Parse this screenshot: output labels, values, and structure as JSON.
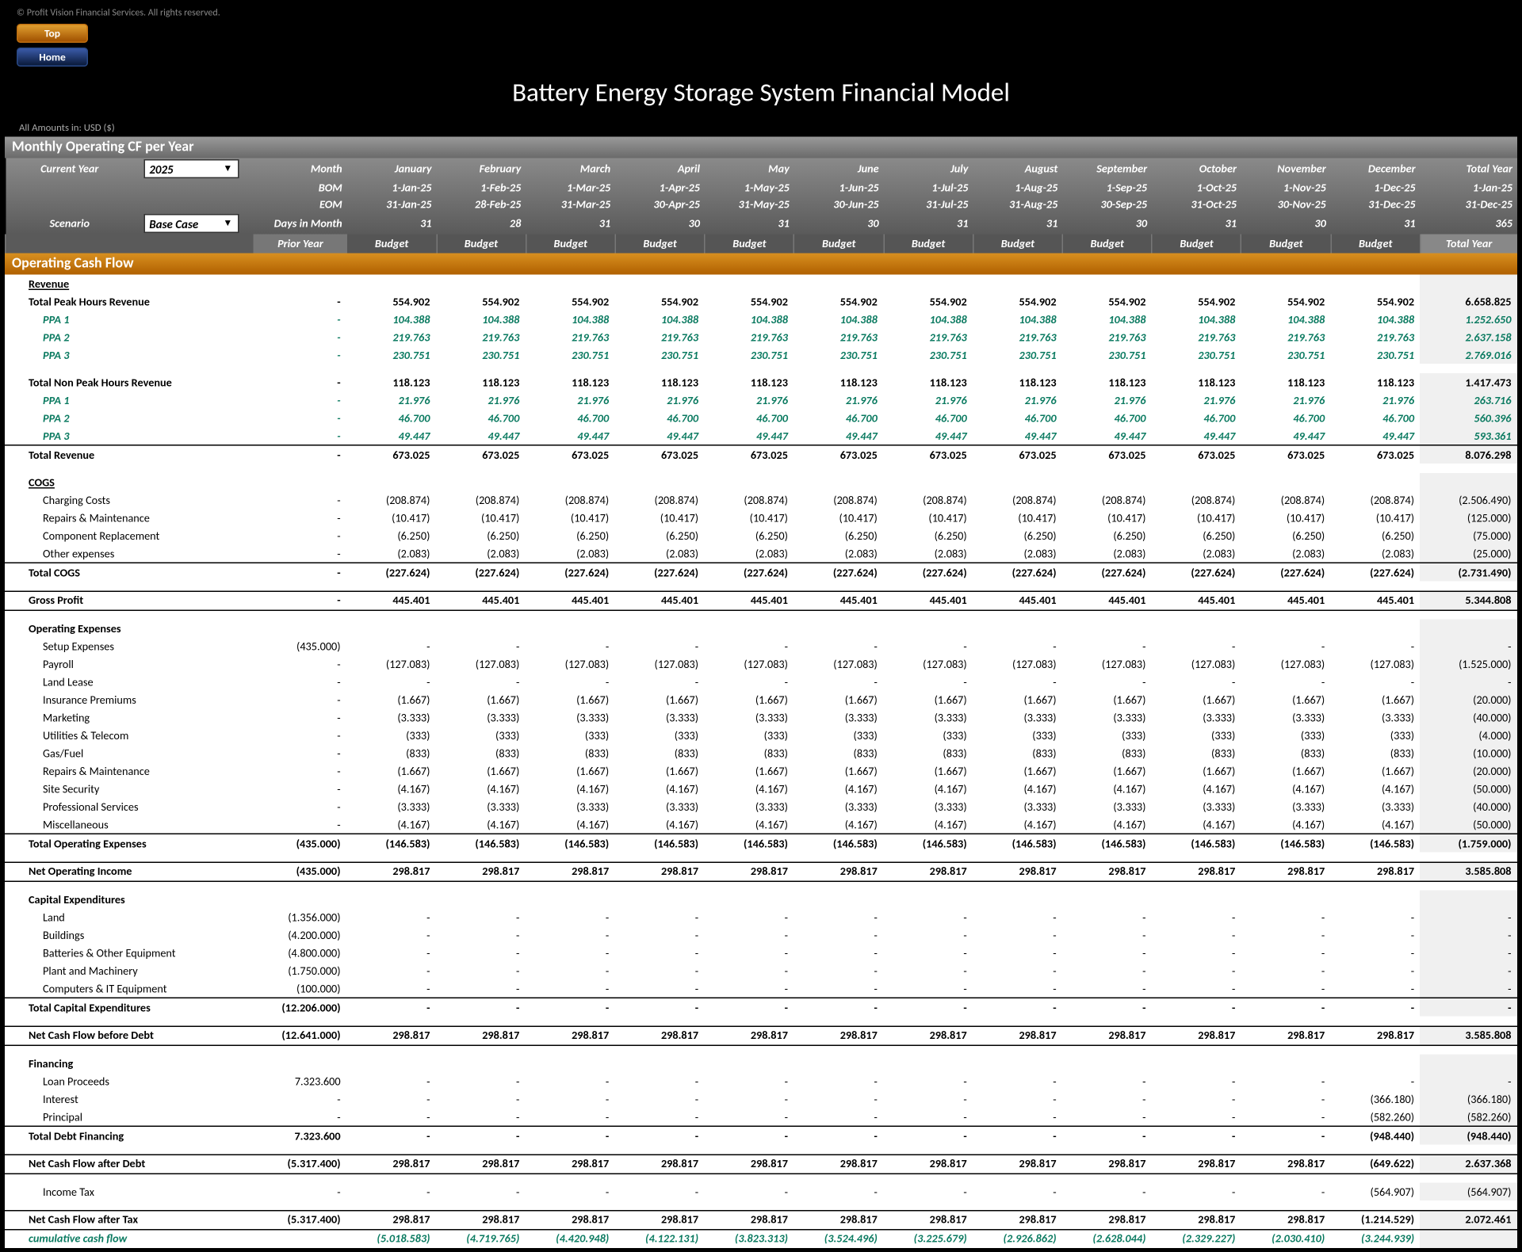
{
  "copyright": "© Profit Vision Financial Services. All rights reserved.",
  "nav": {
    "top": "Top",
    "home": "Home"
  },
  "title": "Battery Energy Storage System Financial Model",
  "amounts_note": "All Amounts in: USD ($)",
  "section_title": "Monthly Operating CF per Year",
  "controls": {
    "current_year_label": "Current Year",
    "current_year_value": "2025",
    "scenario_label": "Scenario",
    "scenario_value": "Base Case"
  },
  "header": {
    "month_label": "Month",
    "bom_label": "BOM",
    "eom_label": "EOM",
    "days_label": "Days in Month",
    "months": [
      "January",
      "February",
      "March",
      "April",
      "May",
      "June",
      "July",
      "August",
      "September",
      "October",
      "November",
      "December"
    ],
    "bom": [
      "1-Jan-25",
      "1-Feb-25",
      "1-Mar-25",
      "1-Apr-25",
      "1-May-25",
      "1-Jun-25",
      "1-Jul-25",
      "1-Aug-25",
      "1-Sep-25",
      "1-Oct-25",
      "1-Nov-25",
      "1-Dec-25"
    ],
    "eom": [
      "31-Jan-25",
      "28-Feb-25",
      "31-Mar-25",
      "30-Apr-25",
      "31-May-25",
      "30-Jun-25",
      "31-Jul-25",
      "31-Aug-25",
      "30-Sep-25",
      "31-Oct-25",
      "30-Nov-25",
      "31-Dec-25"
    ],
    "days": [
      "31",
      "28",
      "31",
      "30",
      "31",
      "30",
      "31",
      "31",
      "30",
      "31",
      "30",
      "31"
    ],
    "total_year": "Total Year",
    "total_bom": "1-Jan-25",
    "total_eom": "31-Dec-25",
    "total_days": "365",
    "prior_year": "Prior Year",
    "budget": "Budget"
  },
  "ocf_title": "Operating Cash Flow",
  "rows": [
    {
      "t": "sechead",
      "label": "Revenue"
    },
    {
      "t": "bold",
      "label": "Total Peak Hours Revenue",
      "prior": "-",
      "m": "554.902",
      "total": "6.658.825"
    },
    {
      "t": "ppa",
      "label": "PPA 1",
      "prior": "-",
      "m": "104.388",
      "total": "1.252.650"
    },
    {
      "t": "ppa",
      "label": "PPA 2",
      "prior": "-",
      "m": "219.763",
      "total": "2.637.158"
    },
    {
      "t": "ppa",
      "label": "PPA 3",
      "prior": "-",
      "m": "230.751",
      "total": "2.769.016"
    },
    {
      "t": "spacer"
    },
    {
      "t": "bold",
      "label": "Total Non Peak Hours Revenue",
      "prior": "-",
      "m": "118.123",
      "total": "1.417.473"
    },
    {
      "t": "ppa",
      "label": "PPA 1",
      "prior": "-",
      "m": "21.976",
      "total": "263.716"
    },
    {
      "t": "ppa",
      "label": "PPA 2",
      "prior": "-",
      "m": "46.700",
      "total": "560.396"
    },
    {
      "t": "ppa",
      "label": "PPA 3",
      "prior": "-",
      "m": "49.447",
      "total": "593.361"
    },
    {
      "t": "totalline",
      "label": "Total Revenue",
      "prior": "-",
      "m": "673.025",
      "total": "8.076.298"
    },
    {
      "t": "spacer"
    },
    {
      "t": "sechead",
      "label": "COGS"
    },
    {
      "t": "sub",
      "label": "Charging Costs",
      "prior": "-",
      "m": "(208.874)",
      "total": "(2.506.490)"
    },
    {
      "t": "sub",
      "label": "Repairs & Maintenance",
      "prior": "-",
      "m": "(10.417)",
      "total": "(125.000)"
    },
    {
      "t": "sub",
      "label": "Component Replacement",
      "prior": "-",
      "m": "(6.250)",
      "total": "(75.000)"
    },
    {
      "t": "sub",
      "label": "Other expenses",
      "prior": "-",
      "m": "(2.083)",
      "total": "(25.000)"
    },
    {
      "t": "totalline",
      "label": "Total COGS",
      "prior": "-",
      "m": "(227.624)",
      "total": "(2.731.490)"
    },
    {
      "t": "spacer"
    },
    {
      "t": "totalline",
      "label": "Gross Profit",
      "prior": "-",
      "m": "445.401",
      "total": "5.344.808",
      "double": true
    },
    {
      "t": "spacer"
    },
    {
      "t": "bold",
      "label": "Operating Expenses"
    },
    {
      "t": "sub",
      "label": "Setup Expenses",
      "prior": "(435.000)",
      "m": "-",
      "total": "-"
    },
    {
      "t": "sub",
      "label": "Payroll",
      "prior": "-",
      "m": "(127.083)",
      "total": "(1.525.000)"
    },
    {
      "t": "sub",
      "label": "Land Lease",
      "prior": "-",
      "m": "-",
      "total": "-"
    },
    {
      "t": "sub",
      "label": "Insurance Premiums",
      "prior": "-",
      "m": "(1.667)",
      "total": "(20.000)"
    },
    {
      "t": "sub",
      "label": "Marketing",
      "prior": "-",
      "m": "(3.333)",
      "total": "(40.000)"
    },
    {
      "t": "sub",
      "label": "Utilities & Telecom",
      "prior": "-",
      "m": "(333)",
      "total": "(4.000)"
    },
    {
      "t": "sub",
      "label": "Gas/Fuel",
      "prior": "-",
      "m": "(833)",
      "total": "(10.000)"
    },
    {
      "t": "sub",
      "label": "Repairs & Maintenance",
      "prior": "-",
      "m": "(1.667)",
      "total": "(20.000)"
    },
    {
      "t": "sub",
      "label": "Site Security",
      "prior": "-",
      "m": "(4.167)",
      "total": "(50.000)"
    },
    {
      "t": "sub",
      "label": "Professional Services",
      "prior": "-",
      "m": "(3.333)",
      "total": "(40.000)"
    },
    {
      "t": "sub",
      "label": "Miscellaneous",
      "prior": "-",
      "m": "(4.167)",
      "total": "(50.000)"
    },
    {
      "t": "totalline",
      "label": "Total Operating Expenses",
      "prior": "(435.000)",
      "m": "(146.583)",
      "total": "(1.759.000)"
    },
    {
      "t": "spacer"
    },
    {
      "t": "totalline",
      "label": "Net Operating Income",
      "prior": "(435.000)",
      "m": "298.817",
      "total": "3.585.808",
      "double": true
    },
    {
      "t": "spacer"
    },
    {
      "t": "bold",
      "label": "Capital Expenditures"
    },
    {
      "t": "sub",
      "label": "Land",
      "prior": "(1.356.000)",
      "m": "-",
      "total": "-"
    },
    {
      "t": "sub",
      "label": "Buildings",
      "prior": "(4.200.000)",
      "m": "-",
      "total": "-"
    },
    {
      "t": "sub",
      "label": "Batteries & Other Equipment",
      "prior": "(4.800.000)",
      "m": "-",
      "total": "-"
    },
    {
      "t": "sub",
      "label": "Plant and Machinery",
      "prior": "(1.750.000)",
      "m": "-",
      "total": "-"
    },
    {
      "t": "sub",
      "label": "Computers & IT Equipment",
      "prior": "(100.000)",
      "m": "-",
      "total": "-"
    },
    {
      "t": "totalline",
      "label": "Total Capital Expenditures",
      "prior": "(12.206.000)",
      "m": "-",
      "total": "-"
    },
    {
      "t": "spacer"
    },
    {
      "t": "totalline",
      "label": "Net Cash Flow before Debt",
      "prior": "(12.641.000)",
      "m": "298.817",
      "total": "3.585.808",
      "double": true
    },
    {
      "t": "spacer"
    },
    {
      "t": "bold",
      "label": "Financing"
    },
    {
      "t": "sub",
      "label": "Loan Proceeds",
      "prior": "7.323.600",
      "m": "-",
      "total": "-"
    },
    {
      "t": "sub",
      "label": "Interest",
      "prior": "-",
      "vals": [
        "-",
        "-",
        "-",
        "-",
        "-",
        "-",
        "-",
        "-",
        "-",
        "-",
        "-",
        "(366.180)"
      ],
      "total": "(366.180)"
    },
    {
      "t": "sub",
      "label": "Principal",
      "prior": "-",
      "vals": [
        "-",
        "-",
        "-",
        "-",
        "-",
        "-",
        "-",
        "-",
        "-",
        "-",
        "-",
        "(582.260)"
      ],
      "total": "(582.260)"
    },
    {
      "t": "totalline",
      "label": "Total Debt Financing",
      "prior": "7.323.600",
      "vals": [
        "-",
        "-",
        "-",
        "-",
        "-",
        "-",
        "-",
        "-",
        "-",
        "-",
        "-",
        "(948.440)"
      ],
      "total": "(948.440)"
    },
    {
      "t": "spacer"
    },
    {
      "t": "totalline",
      "label": "Net Cash Flow after Debt",
      "prior": "(5.317.400)",
      "vals": [
        "298.817",
        "298.817",
        "298.817",
        "298.817",
        "298.817",
        "298.817",
        "298.817",
        "298.817",
        "298.817",
        "298.817",
        "298.817",
        "(649.622)"
      ],
      "total": "2.637.368",
      "double": true
    },
    {
      "t": "spacer"
    },
    {
      "t": "sub",
      "label": "Income Tax",
      "prior": "-",
      "vals": [
        "-",
        "-",
        "-",
        "-",
        "-",
        "-",
        "-",
        "-",
        "-",
        "-",
        "-",
        "(564.907)"
      ],
      "total": "(564.907)"
    },
    {
      "t": "spacer"
    },
    {
      "t": "totalline",
      "label": "Net Cash Flow after Tax",
      "prior": "(5.317.400)",
      "vals": [
        "298.817",
        "298.817",
        "298.817",
        "298.817",
        "298.817",
        "298.817",
        "298.817",
        "298.817",
        "298.817",
        "298.817",
        "298.817",
        "(1.214.529)"
      ],
      "total": "2.072.461",
      "double": true
    },
    {
      "t": "cum",
      "label": "cumulative cash flow",
      "prior": "",
      "vals": [
        "(5.018.583)",
        "(4.719.765)",
        "(4.420.948)",
        "(4.122.131)",
        "(3.823.313)",
        "(3.524.496)",
        "(3.225.679)",
        "(2.926.862)",
        "(2.628.044)",
        "(2.329.227)",
        "(2.030.410)",
        "(3.244.939)"
      ],
      "total": ""
    }
  ]
}
